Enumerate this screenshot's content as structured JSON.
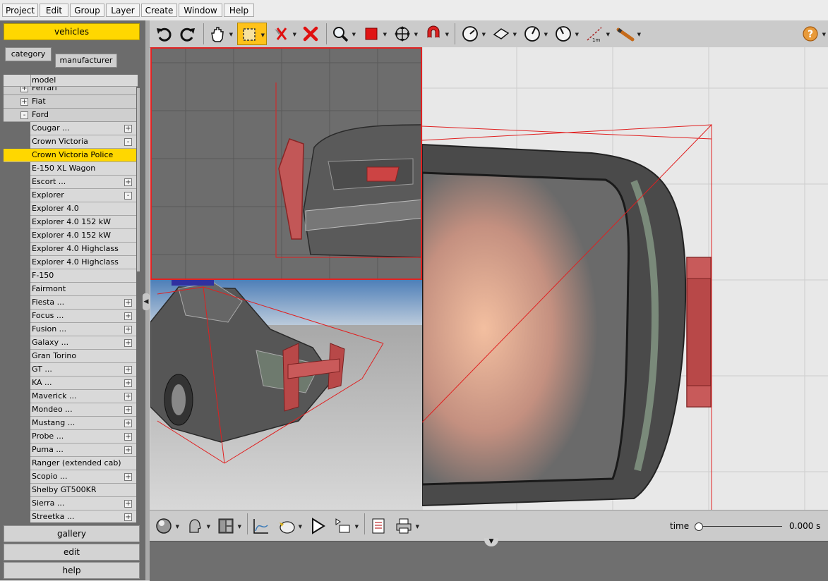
{
  "menu": [
    "Project",
    "Edit",
    "Group",
    "Layer",
    "Create",
    "Window",
    "Help"
  ],
  "left_panel": {
    "active_tab": "vehicles",
    "group_buttons": [
      "category",
      "manufacturer"
    ],
    "column_header": "model",
    "tree": [
      {
        "label": "Ferrari",
        "level": 0,
        "toggle": "+"
      },
      {
        "label": "Fiat",
        "level": 0,
        "toggle": "+"
      },
      {
        "label": "Ford",
        "level": 0,
        "toggle": "-"
      },
      {
        "label": "Cougar ...",
        "level": 1,
        "toggle": "+"
      },
      {
        "label": "Crown Victoria",
        "level": 1,
        "toggle": "-"
      },
      {
        "label": "Crown Victoria Police",
        "level": 1,
        "toggle": "",
        "selected": true
      },
      {
        "label": "E-150 XL Wagon",
        "level": 1,
        "toggle": ""
      },
      {
        "label": "Escort ...",
        "level": 1,
        "toggle": "+"
      },
      {
        "label": "Explorer",
        "level": 1,
        "toggle": "-"
      },
      {
        "label": "Explorer 4.0",
        "level": 1,
        "toggle": ""
      },
      {
        "label": "Explorer 4.0 152 kW",
        "level": 1,
        "toggle": ""
      },
      {
        "label": "Explorer 4.0 152 kW",
        "level": 1,
        "toggle": ""
      },
      {
        "label": "Explorer 4.0 Highclass",
        "level": 1,
        "toggle": ""
      },
      {
        "label": "Explorer 4.0 Highclass",
        "level": 1,
        "toggle": ""
      },
      {
        "label": "F-150",
        "level": 1,
        "toggle": ""
      },
      {
        "label": "Fairmont",
        "level": 1,
        "toggle": ""
      },
      {
        "label": "Fiesta ...",
        "level": 1,
        "toggle": "+"
      },
      {
        "label": "Focus ...",
        "level": 1,
        "toggle": "+"
      },
      {
        "label": "Fusion ...",
        "level": 1,
        "toggle": "+"
      },
      {
        "label": "Galaxy ...",
        "level": 1,
        "toggle": "+"
      },
      {
        "label": "Gran Torino",
        "level": 1,
        "toggle": ""
      },
      {
        "label": "GT ...",
        "level": 1,
        "toggle": "+"
      },
      {
        "label": "KA ...",
        "level": 1,
        "toggle": "+"
      },
      {
        "label": "Maverick ...",
        "level": 1,
        "toggle": "+"
      },
      {
        "label": "Mondeo ...",
        "level": 1,
        "toggle": "+"
      },
      {
        "label": "Mustang ...",
        "level": 1,
        "toggle": "+"
      },
      {
        "label": "Probe ...",
        "level": 1,
        "toggle": "+"
      },
      {
        "label": "Puma ...",
        "level": 1,
        "toggle": "+"
      },
      {
        "label": "Ranger (extended cab)",
        "level": 1,
        "toggle": ""
      },
      {
        "label": "Scopio ...",
        "level": 1,
        "toggle": "+"
      },
      {
        "label": "Shelby GT500KR",
        "level": 1,
        "toggle": ""
      },
      {
        "label": "Sierra ...",
        "level": 1,
        "toggle": "+"
      },
      {
        "label": "Streetka ...",
        "level": 1,
        "toggle": "+"
      }
    ],
    "bottom_tabs": [
      "gallery",
      "edit",
      "help"
    ]
  },
  "toolbar": {
    "icons": [
      "undo-icon",
      "redo-icon",
      "pan-hand-icon",
      "select-rectangle-icon",
      "deselect-icon",
      "delete-icon",
      "zoom-icon",
      "color-swatch-icon",
      "move-icon",
      "magnet-icon",
      "rotate-icon",
      "plane-icon",
      "angle-icon",
      "measure-angle-icon",
      "ruler-icon",
      "marker-icon",
      "help-icon"
    ],
    "ruler_label": "1m",
    "swatch_color": "#e01515",
    "select_color": "#ffc21a"
  },
  "bottom_toolbar": {
    "icons": [
      "sphere-render-icon",
      "head-icon",
      "layout-icon",
      "graph-icon",
      "camera-icon",
      "play-icon",
      "sequence-icon",
      "report-icon",
      "print-icon"
    ],
    "time_label": "time",
    "time_value": "0.000 s",
    "time_position": 0
  },
  "colors": {
    "accent": "#ffd700",
    "selection_box": "#e12222",
    "bumper": "#b94a4a"
  }
}
